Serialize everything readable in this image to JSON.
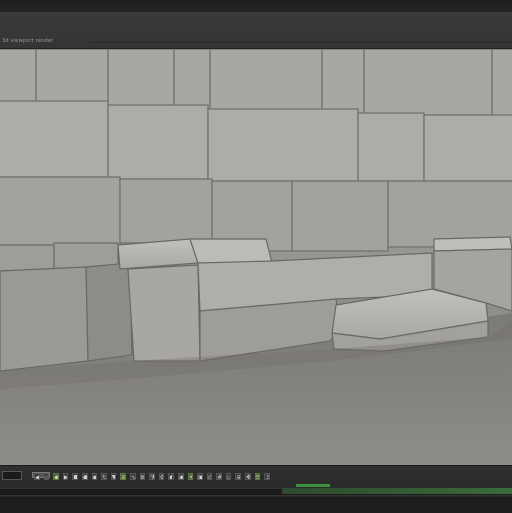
{
  "app": {
    "subbar_title": "3d viewport render"
  },
  "colors": {
    "chrome_dark": "#2b2b2b",
    "toolbar": "#3a3a3a",
    "stone": "#a8a6a1",
    "ground": "#8a8884",
    "timeline_key": "#3c8f3c"
  },
  "toolbar": {
    "icons": [
      "play-back-icon",
      "step-back-icon",
      "key-icon",
      "play-icon",
      "stop-icon",
      "record-icon",
      "keyframe-icon",
      "loop-icon",
      "marker-icon",
      "snap-icon",
      "curve-icon",
      "graph-icon",
      "filter-icon",
      "settings-icon",
      "onion-icon",
      "camera-icon",
      "light-icon",
      "render-icon",
      "view-icon",
      "grid-icon",
      "frame-icon",
      "zoom-icon",
      "pan-icon",
      "orbit-icon",
      "export-icon"
    ]
  },
  "timeline": {
    "progress": 0.45
  }
}
